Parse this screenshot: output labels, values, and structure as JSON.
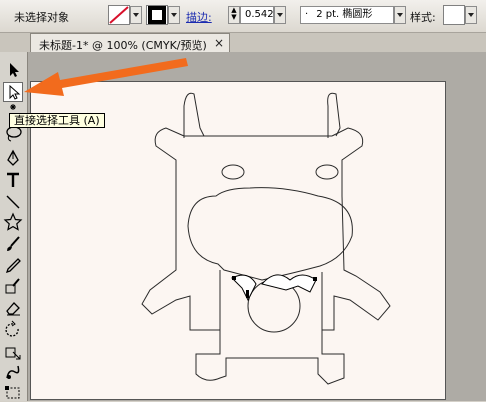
{
  "control_bar": {
    "selection_status": "未选择对象",
    "stroke_label": "描边:",
    "stroke_weight": "0.542",
    "brush_value": "2 pt. 椭圆形",
    "style_label": "样式:"
  },
  "document_tab": {
    "title": "未标题-1* @ 100% (CMYK/预览)",
    "close": "×"
  },
  "tooltip": {
    "text": "直接选择工具 (A)"
  },
  "toolbox": {
    "tools": [
      "selection-tool",
      "direct-selection-tool",
      "magic-wand-tool",
      "lasso-tool",
      "pen-tool",
      "type-tool",
      "line-segment-tool",
      "rectangle-tool",
      "paintbrush-tool",
      "pencil-tool",
      "blob-brush-tool",
      "eraser-tool",
      "rotate-tool",
      "scale-tool",
      "warp-tool",
      "free-transform-tool"
    ],
    "active": "direct-selection-tool"
  },
  "colors": {
    "artboard": "#fcf6f2",
    "arrow": "#f26b1d",
    "link": "#1b2bb0"
  }
}
